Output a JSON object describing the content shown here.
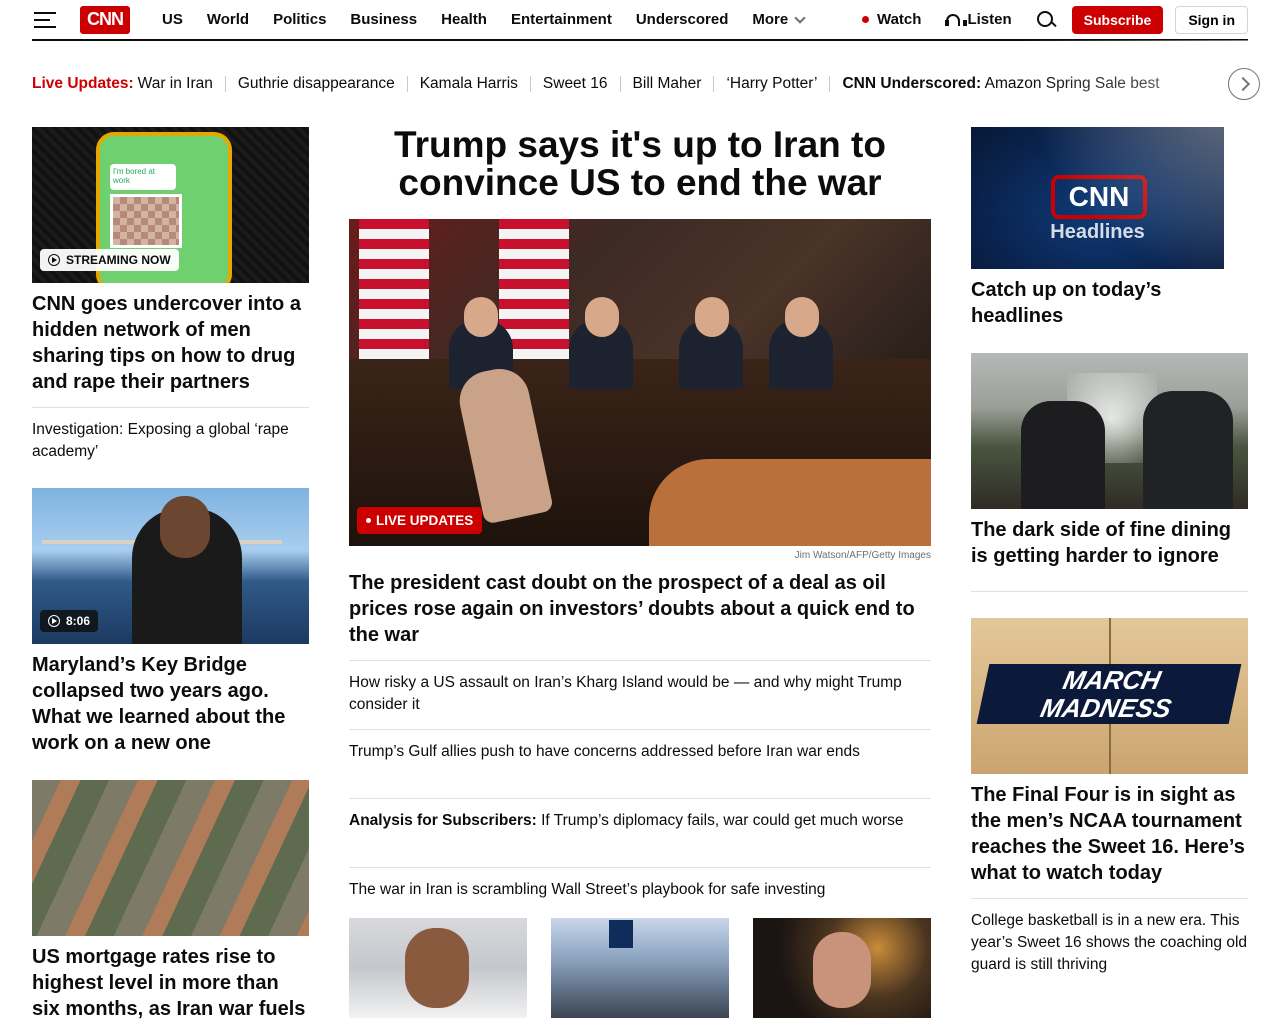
{
  "header": {
    "logo": "CNN",
    "nav": [
      "US",
      "World",
      "Politics",
      "Business",
      "Health",
      "Entertainment",
      "Underscored"
    ],
    "more": "More",
    "watch": "Watch",
    "listen": "Listen",
    "subscribe": "Subscribe",
    "signin": "Sign in"
  },
  "ticker": {
    "lead_label": "Live Updates:",
    "lead_text": "War in Iran",
    "items": [
      "Guthrie disappearance",
      "Kamala Harris",
      "Sweet 16",
      "Bill Maher",
      "‘Harry Potter’"
    ],
    "promo_label": "CNN Underscored:",
    "promo_text": "Amazon Spring Sale best"
  },
  "left": {
    "story1": {
      "badge": "STREAMING NOW",
      "bubble": "I'm bored at work",
      "headline": "CNN goes undercover into a hidden network of men sharing tips on how to drug and rape their partners",
      "sub": "Investigation: Exposing a global ‘rape academy’"
    },
    "story2": {
      "duration": "8:06",
      "headline": "Maryland’s Key Bridge collapsed two years ago. What we learned about the work on a new one"
    },
    "story3": {
      "headline": "US mortgage rates rise to highest level in more than six months, as Iran war fuels"
    }
  },
  "center": {
    "headline": "Trump says it's up to Iran to convince US to end the war",
    "live_badge": "LIVE UPDATES",
    "credit": "Jim Watson/AFP/Getty Images",
    "deck": "The president cast doubt on the prospect of a deal as oil prices rose again on investors’ doubts about a quick end to the war",
    "links": [
      "How risky a US assault on Iran’s Kharg Island would be — and why might Trump consider it",
      "Trump’s Gulf allies push to have concerns addressed before Iran war ends"
    ],
    "analysis_label": "Analysis for Subscribers:",
    "analysis_text": " If Trump’s diplomacy fails, war could get much worse",
    "last_link": "The war in Iran is scrambling Wall Street’s playbook for safe investing"
  },
  "right": {
    "headlines_video": {
      "mark": "CNN",
      "label": "Headlines",
      "headline": "Catch up on today’s headlines"
    },
    "dining": {
      "headline": "The dark side of fine dining is getting harder to ignore"
    },
    "ncaa": {
      "graphic_line1": "MARCH",
      "graphic_line2": "MADNESS",
      "headline": "The Final Four is in sight as the men’s NCAA tournament reaches the Sweet 16. Here’s what to watch today",
      "sub": "College basketball is in a new era. This year’s Sweet 16 shows the coaching old guard is still thriving"
    }
  },
  "colors": {
    "brand_red": "#cc0000",
    "text": "#0c0c0c"
  },
  "icons": [
    "menu-icon",
    "chevron-down-icon",
    "live-dot-icon",
    "headphones-icon",
    "search-icon",
    "chevron-right-icon",
    "play-icon"
  ]
}
